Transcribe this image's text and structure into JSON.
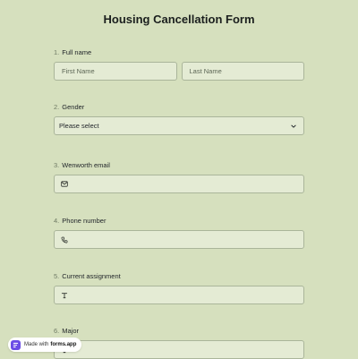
{
  "form": {
    "title": "Housing Cancellation Form",
    "questions": [
      {
        "num": "1.",
        "label": "Full name",
        "first_placeholder": "First Name",
        "last_placeholder": "Last Name"
      },
      {
        "num": "2.",
        "label": "Gender",
        "value": "Please select"
      },
      {
        "num": "3.",
        "label": "Wenworth email",
        "icon": "mail-icon"
      },
      {
        "num": "4.",
        "label": "Phone number",
        "icon": "phone-icon"
      },
      {
        "num": "5.",
        "label": "Current assignment",
        "icon": "text-icon"
      },
      {
        "num": "6.",
        "label": "Major",
        "icon": "text-icon"
      }
    ]
  },
  "badge": {
    "prefix": "Made with",
    "brand": "forms.app"
  }
}
